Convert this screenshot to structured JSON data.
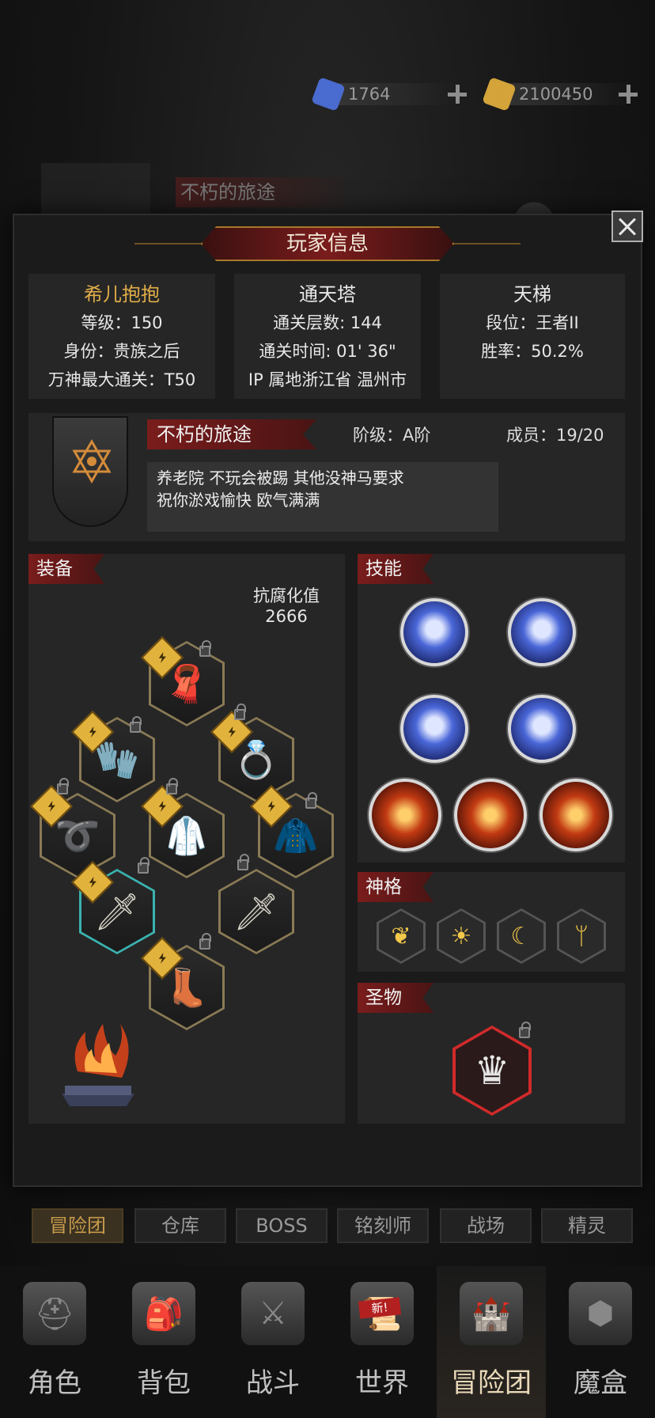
{
  "currency": {
    "gems": "1764",
    "gold": "2100450",
    "gem_color": "#4a6bcf",
    "gold_color": "#d4a43a"
  },
  "background": {
    "guild_name": "不朽的旅途"
  },
  "dialog": {
    "title": "玩家信息"
  },
  "player": {
    "name": "希儿抱抱",
    "level_label": "等级：",
    "level": "150",
    "identity_label": "身份：",
    "identity": "贵族之后",
    "max_clear_label": "万神最大通关：",
    "max_clear": "T50"
  },
  "tower": {
    "title": "通天塔",
    "floors": "通关层数: 144",
    "time": "通关时间: 01' 36\"",
    "ip": "IP 属地浙江省 温州市"
  },
  "ladder": {
    "title": "天梯",
    "rank": "段位：王者II",
    "winrate": "胜率：50.2%"
  },
  "guild": {
    "name": "不朽的旅途",
    "tier": "阶级：A阶",
    "members": "成员：19/20",
    "desc_line1": "养老院  不玩会被踢 其他没神马要求",
    "desc_line2": "祝你淤戏愉快 欧气满满"
  },
  "equipment": {
    "title": "装备",
    "corruption_label": "抗腐化值",
    "corruption_value": "2666",
    "slots": [
      {
        "name": "scarf",
        "glyph": "🧣"
      },
      {
        "name": "gauntlet",
        "glyph": "🧤"
      },
      {
        "name": "ring",
        "glyph": "💍"
      },
      {
        "name": "belt",
        "glyph": "➰"
      },
      {
        "name": "armor",
        "glyph": "🥼"
      },
      {
        "name": "cloak",
        "glyph": "🧥"
      },
      {
        "name": "sword-1",
        "glyph": "🗡"
      },
      {
        "name": "sword-2",
        "glyph": "🗡"
      },
      {
        "name": "boots",
        "glyph": "👢"
      }
    ]
  },
  "skills": {
    "title": "技能"
  },
  "divinity": {
    "title": "神格"
  },
  "relic": {
    "title": "圣物"
  },
  "subtabs": [
    "冒险团",
    "仓库",
    "BOSS",
    "铭刻师",
    "战场",
    "精灵"
  ],
  "nav": {
    "items": [
      "角色",
      "背包",
      "战斗",
      "世界",
      "冒险团",
      "魔盒"
    ],
    "new_badge": "新!"
  }
}
